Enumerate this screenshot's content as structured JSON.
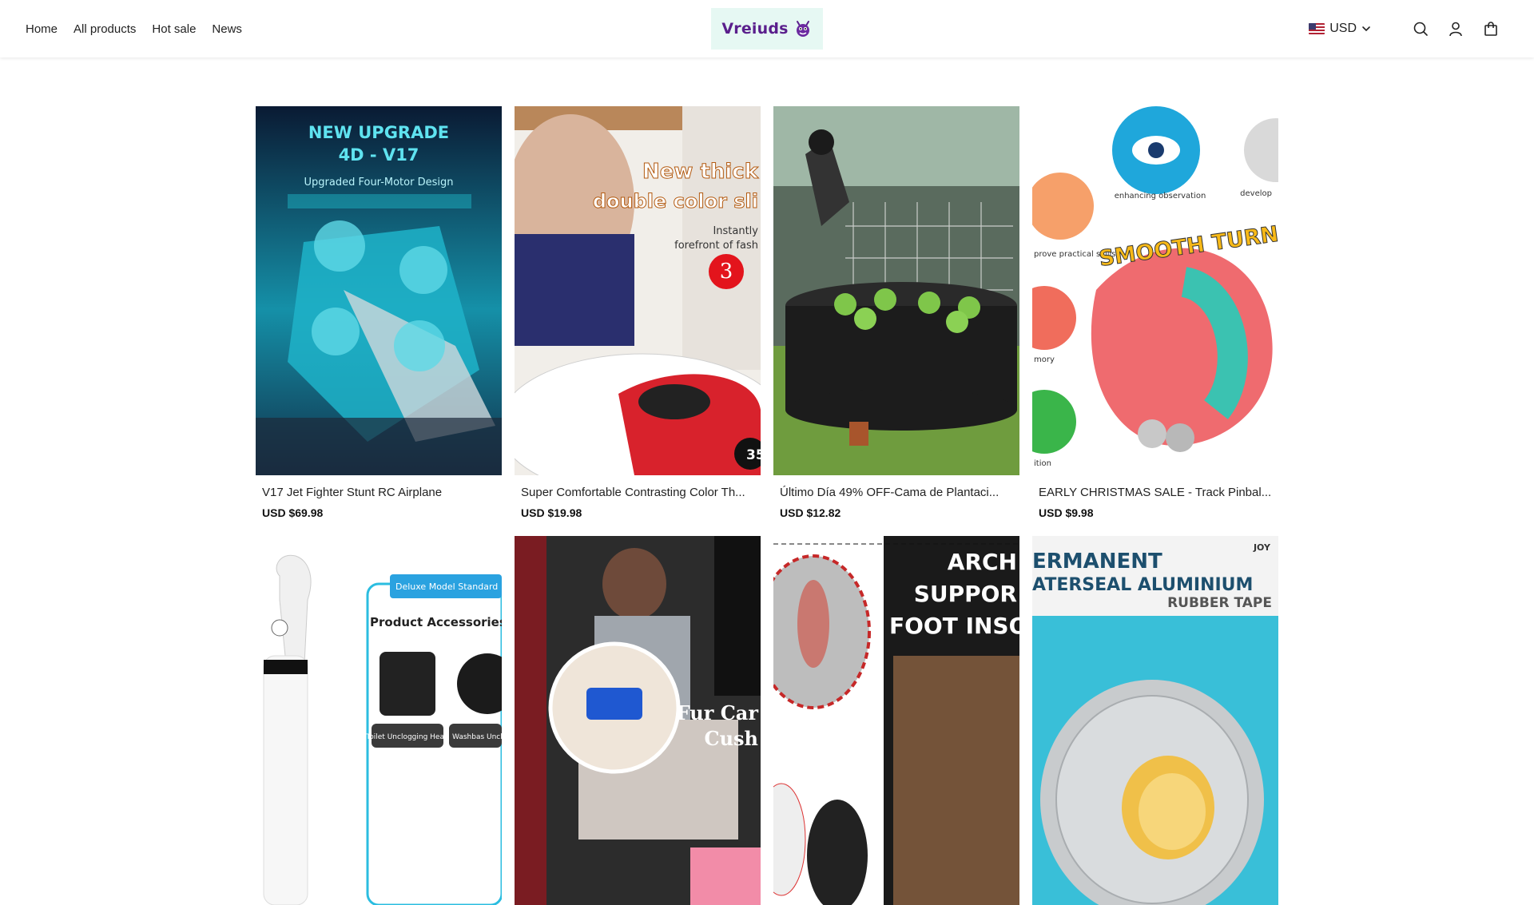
{
  "header": {
    "nav": [
      "Home",
      "All products",
      "Hot sale",
      "News"
    ],
    "logo_text": "Vreiuds",
    "currency": "USD",
    "icons": [
      "us-flag-icon",
      "chevron-down-icon",
      "search-icon",
      "user-icon",
      "cart-icon"
    ]
  },
  "products": [
    {
      "title": "V17 Jet Fighter Stunt RC Airplane",
      "price": "USD $69.98",
      "image_text": [
        "NEW UPGRADE",
        "4D - V17",
        "Upgraded Four-Motor Design"
      ]
    },
    {
      "title": "Super Comfortable Contrasting Color Th...",
      "price": "USD $19.98",
      "image_text": [
        "New thick",
        "double color sli",
        "Instantly",
        "forefront of fash",
        "3",
        "35-"
      ]
    },
    {
      "title": "Último Día 49% OFF-Cama de Plantaci...",
      "price": "USD $12.82",
      "image_text": []
    },
    {
      "title": "EARLY CHRISTMAS SALE - Track Pinbal...",
      "price": "USD $9.98",
      "image_text": [
        "enhancing observation",
        "develop",
        "prove practical skills",
        "SMOOTH TURN",
        "mory",
        "ition"
      ]
    },
    {
      "title": "",
      "price": "",
      "image_text": [
        "Deluxe Model Standard",
        "Product Accessories:",
        "Toilet Unclogging Head",
        "Washbas Unclogging"
      ]
    },
    {
      "title": "",
      "price": "",
      "image_text": [
        "Fur Car",
        "Cush"
      ]
    },
    {
      "title": "",
      "price": "",
      "image_text": [
        "ARCH",
        "SUPPOR",
        "FOOT INSO"
      ]
    },
    {
      "title": "",
      "price": "",
      "image_text": [
        "ERMANENT",
        "ATERSEAL ALUMINIUM",
        "RUBBER TAPE",
        "JOY"
      ]
    }
  ]
}
